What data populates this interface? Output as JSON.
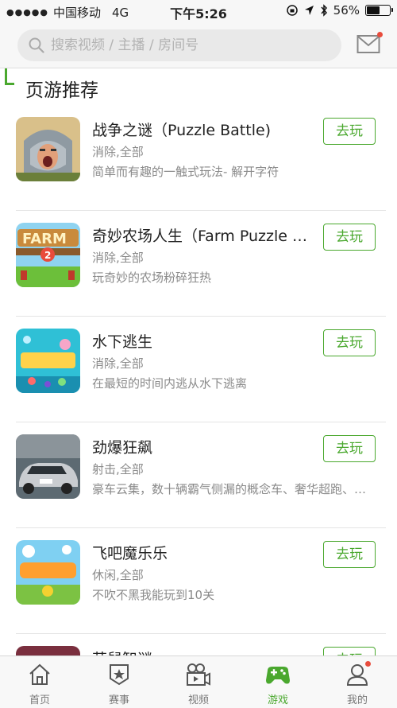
{
  "status": {
    "carrier": "中国移动",
    "network": "4G",
    "time": "下午5:26",
    "battery": "56%",
    "battery_level": 0.56
  },
  "search": {
    "placeholder": "搜索视频 / 主播 / 房间号"
  },
  "section": {
    "title": "页游推荐"
  },
  "games": [
    {
      "name": "战争之谜（Puzzle Battle)",
      "category": "消除,全部",
      "desc": "简单而有趣的一触式玩法- 解开字符",
      "button": "去玩",
      "icon": "warrior-thumbnail"
    },
    {
      "name": "奇妙农场人生（Farm Puzzle Story)",
      "category": "消除,全部",
      "desc": "玩奇妙的农场粉碎狂热",
      "button": "去玩",
      "icon": "farm-thumbnail"
    },
    {
      "name": "水下逃生",
      "category": "消除,全部",
      "desc": "在最短的时间内逃从水下逃离",
      "button": "去玩",
      "icon": "underwater-thumbnail"
    },
    {
      "name": "劲爆狂飙",
      "category": "射击,全部",
      "desc": "豪车云集，数十辆霸气侧漏的概念车、奢华超跑、经典老爷车",
      "button": "去玩",
      "icon": "car-thumbnail"
    },
    {
      "name": "飞吧魔乐乐",
      "category": "休闲,全部",
      "desc": "不吹不黑我能玩到10关",
      "button": "去玩",
      "icon": "flying-thumbnail"
    },
    {
      "name": "萌鼠智谜",
      "category": "",
      "desc": "",
      "button": "去玩",
      "icon": "mouse-thumbnail"
    }
  ],
  "tabs": [
    {
      "label": "首页",
      "icon": "home-icon"
    },
    {
      "label": "赛事",
      "icon": "trophy-badge-icon"
    },
    {
      "label": "视频",
      "icon": "video-camera-icon"
    },
    {
      "label": "游戏",
      "icon": "gamepad-icon"
    },
    {
      "label": "我的",
      "icon": "user-icon"
    }
  ],
  "colors": {
    "accent": "#4aa82e",
    "notification": "#e84c3d"
  }
}
